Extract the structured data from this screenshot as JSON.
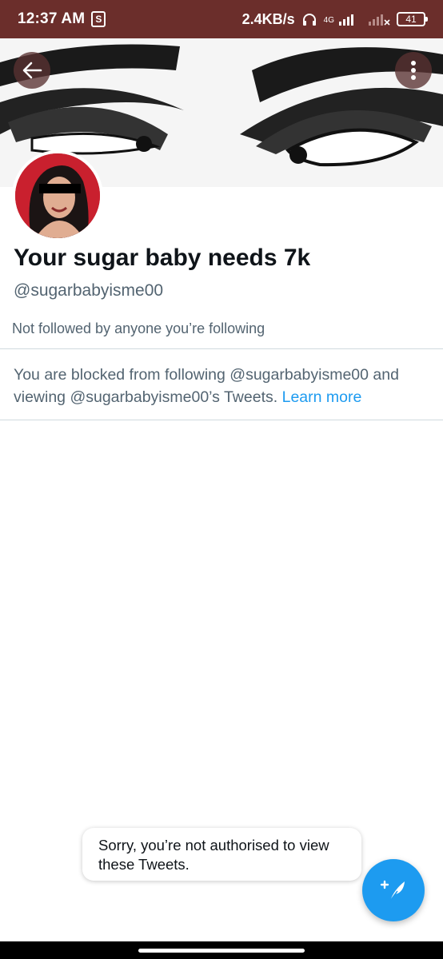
{
  "status_bar": {
    "time": "12:37 AM",
    "shop_icon": "S",
    "net_speed": "2.4KB/s",
    "network": "4G",
    "battery": "41"
  },
  "header": {
    "back_icon": "arrow-left-icon",
    "more_icon": "vertical-dots-icon"
  },
  "profile": {
    "display_name": "Your sugar baby needs 7k",
    "handle": "@sugarbabyisme00",
    "followers_note": "Not followed by anyone you’re following"
  },
  "blocked_notice": {
    "text": "You are blocked from following @sugarbabyisme00 and viewing @sugarbabyisme00’s Tweets.",
    "link": "Learn more"
  },
  "toast": {
    "message": "Sorry, you’re not authorised to view these Tweets."
  },
  "fab": {
    "icon": "compose-tweet-icon"
  },
  "colors": {
    "status_bar": "#6b2e2b",
    "accent": "#1d9bf0",
    "secondary_text": "#536471"
  }
}
